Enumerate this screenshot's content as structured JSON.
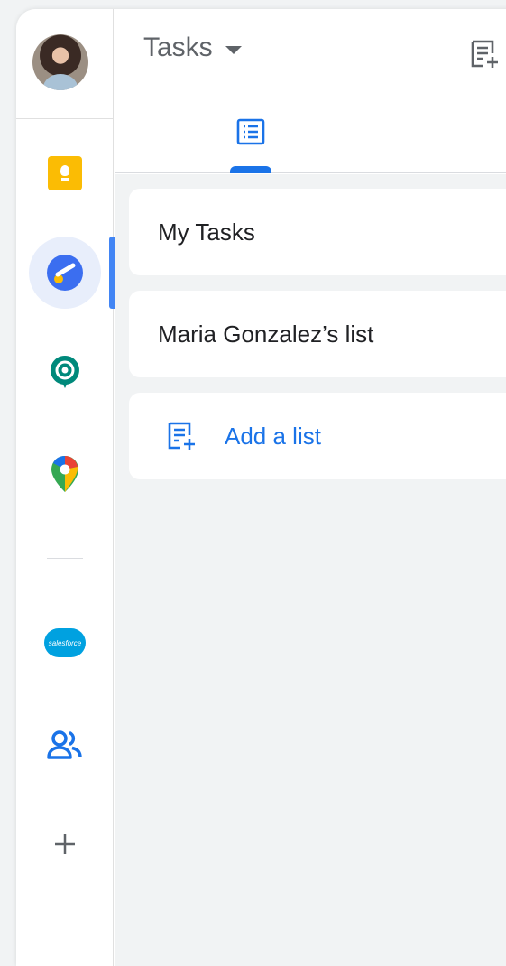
{
  "header": {
    "title": "Tasks"
  },
  "lists": [
    {
      "label": "My Tasks"
    },
    {
      "label": "Maria Gonzalez’s list"
    }
  ],
  "add_list": {
    "label": "Add a list"
  },
  "rail": {
    "salesforce_label": "salesforce"
  },
  "colors": {
    "accent": "#1a73e8",
    "tasks_blue": "#4285f4",
    "keep_yellow": "#fbbc04",
    "chat_green": "#00897b",
    "salesforce_blue": "#00a1e0"
  }
}
